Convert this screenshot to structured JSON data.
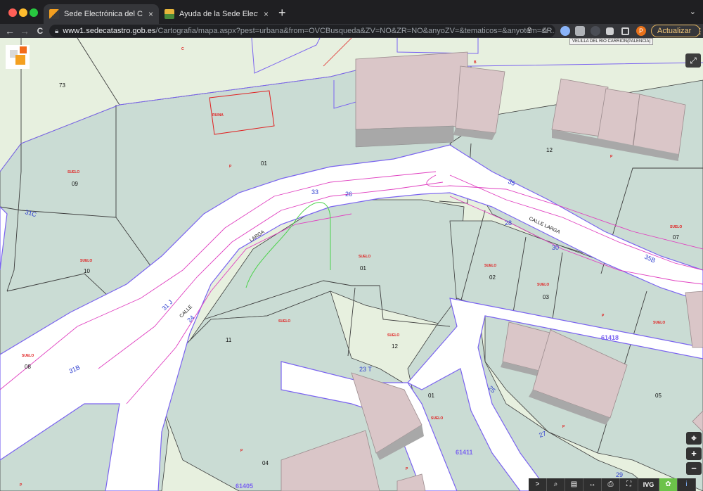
{
  "tabs": [
    {
      "title": "Sede Electrónica del Catastro",
      "close": "×",
      "active": true,
      "favicon_color": "#f4a020"
    },
    {
      "title": "Ayuda de la Sede Electrónica d",
      "close": "×",
      "active": false,
      "favicon_color": "#e7b53a"
    }
  ],
  "new_tab": "+",
  "tab_menu": "⌄",
  "toolbar": {
    "back": "←",
    "forward": "→",
    "reload": "C",
    "lock": "🔒",
    "url_host": "www1.sedecatastro.gob.es",
    "url_path": "/Cartografia/mapa.aspx?pest=urbana&from=OVCBusqueda&ZV=NO&ZR=NO&anyoZV=&tematicos=&anyotem=&R...",
    "share": "⇪",
    "bookmark": "☆",
    "profile_initial": "P",
    "update_label": "Actualizar",
    "menu": "⋮"
  },
  "tooltip": "VELILLA DEL RIO CARRION(PALENCIA)",
  "map": {
    "parcel_numbers": [
      "73",
      "01",
      "09",
      "10",
      "08",
      "11",
      "01",
      "12",
      "02",
      "03",
      "07",
      "12",
      "01",
      "04",
      "05"
    ],
    "street_name": "CALLE LARGA",
    "street_parts": [
      "LARGA",
      "CALLE",
      "CALLE LARGA"
    ],
    "street_numbers": [
      "33",
      "26",
      "35",
      "28",
      "30",
      "35B",
      "31 J",
      "24",
      "31C",
      "31B",
      "23 T",
      "25",
      "27",
      "29"
    ],
    "block_codes": [
      "61418",
      "61411",
      "61405"
    ],
    "land_labels": [
      "SUELO",
      "RUINA",
      "P",
      "C",
      "B"
    ],
    "colors": {
      "parcel_fill": "#cadcd4",
      "street_fill": "#ffffff",
      "parcel_border": "#3d3d3d",
      "street_border": "#7a63f0",
      "contour": "#e040c0",
      "building": "#dac6c8",
      "label_red": "#e02020",
      "label_blue": "#2f3fd0"
    }
  },
  "controls": {
    "fullscreen": "⤢",
    "locate": "⌖",
    "zoom_in": "+",
    "zoom_out": "−",
    "bottom": [
      ">",
      "⌕",
      "▤",
      "↔",
      "⎙",
      "⛶",
      "IVG",
      "✿",
      "i"
    ]
  }
}
